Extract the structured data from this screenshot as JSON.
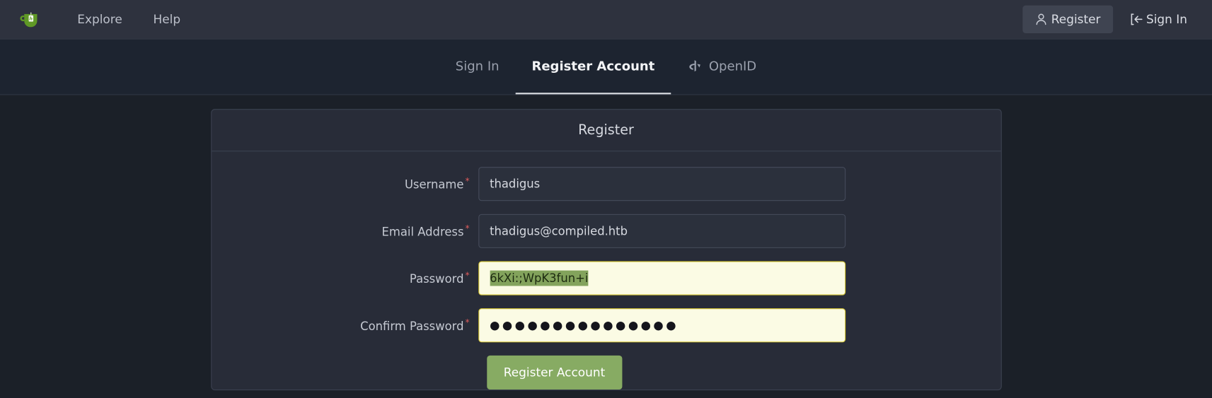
{
  "navbar": {
    "logo_icon": "gitea-teacup-logo",
    "links": [
      {
        "label": "Explore",
        "name": "nav-link-explore"
      },
      {
        "label": "Help",
        "name": "nav-link-help"
      }
    ],
    "register_button": {
      "label": "Register",
      "icon": "person-icon"
    },
    "signin_link": {
      "label": "Sign In",
      "icon": "sign-in-icon"
    }
  },
  "tabs": [
    {
      "label": "Sign In",
      "active": false,
      "icon": null
    },
    {
      "label": "Register Account",
      "active": true,
      "icon": null
    },
    {
      "label": "OpenID",
      "active": false,
      "icon": "openid-icon"
    }
  ],
  "panel": {
    "title": "Register",
    "fields": [
      {
        "label": "Username",
        "required": "*",
        "value": "thadigus",
        "state": "normal"
      },
      {
        "label": "Email Address",
        "required": "*",
        "value": "thadigus@compiled.htb",
        "state": "normal"
      },
      {
        "label": "Password",
        "required": "*",
        "value": "6kXi:;WpK3fun+i",
        "state": "autofill-selected"
      },
      {
        "label": "Confirm Password",
        "required": "*",
        "value": "●●●●●●●●●●●●●●●",
        "state": "autofill-masked"
      }
    ],
    "submit_label": "Register Account"
  },
  "colors": {
    "navbar_bg": "#2e323e",
    "tabbar_bg": "#1d2430",
    "page_bg": "#1b2028",
    "panel_bg": "#282c38",
    "panel_border": "#3b4150",
    "accent_green": "#87ab63",
    "autofill_yellow": "#fbfbe4",
    "selection_green": "#83a35c",
    "required_red": "#e05c5c",
    "brand_green": "#609926"
  }
}
